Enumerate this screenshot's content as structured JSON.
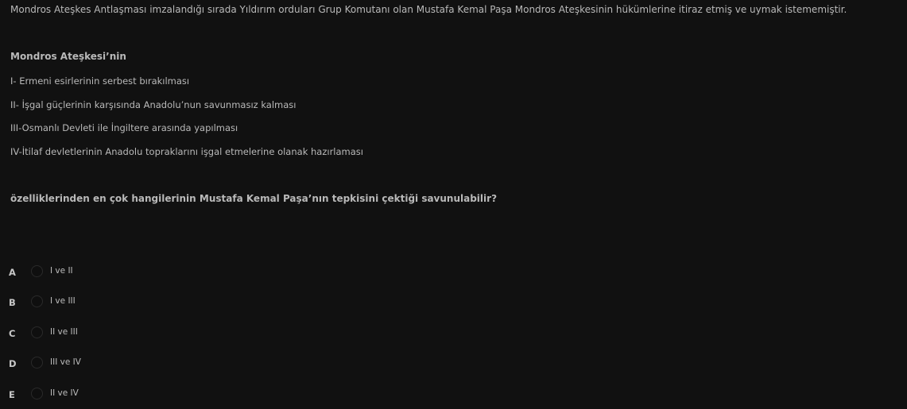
{
  "question": {
    "stem": "Mondros Ateşkes Antlaşması imzalandığı sırada Yıldırım orduları Grup Komutanı olan Mustafa Kemal Paşa Mondros Ateşkesinin hükümlerine itiraz etmiş ve uymak istememiştir.",
    "list_title": "Mondros Ateşkesi’nin",
    "statements": [
      "I-  Ermeni esirlerinin serbest bırakılması",
      "II- İşgal güçlerinin karşısında Anadolu’nun savunmasız kalması",
      "III-Osmanlı Devleti ile İngiltere arasında yapılması",
      "IV-İtilaf devletlerinin Anadolu topraklarını işgal etmelerine olanak hazırlaması"
    ],
    "prompt": "özelliklerinden en çok hangilerinin Mustafa Kemal Paşa’nın tepkisini çektiği savunulabilir?"
  },
  "options": [
    {
      "letter": "A",
      "text": "I ve II"
    },
    {
      "letter": "B",
      "text": "I ve III"
    },
    {
      "letter": "C",
      "text": "II ve III"
    },
    {
      "letter": "D",
      "text": "III ve IV"
    },
    {
      "letter": "E",
      "text": "II ve IV"
    }
  ]
}
